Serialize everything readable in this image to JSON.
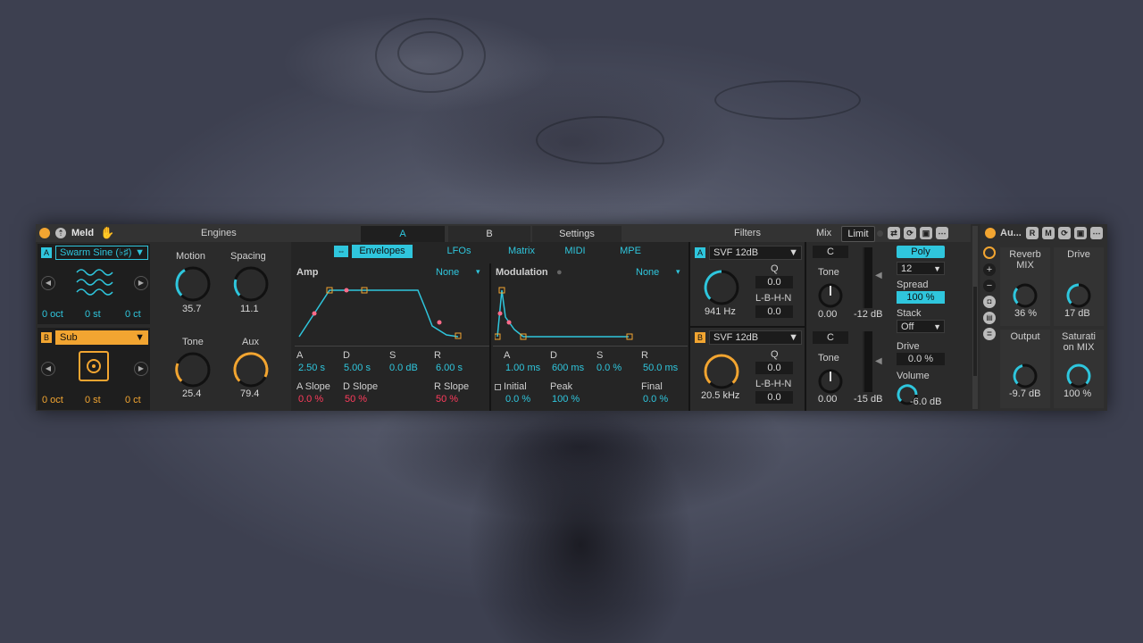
{
  "device_title": "Meld",
  "engines": {
    "header": "Engines",
    "osc_a": {
      "badge": "A",
      "name": "Swarm Sine (♭♯)",
      "oct": "0 oct",
      "st": "0 st",
      "ct": "0 ct"
    },
    "osc_b": {
      "badge": "B",
      "name": "Sub",
      "oct": "0 oct",
      "st": "0 st",
      "ct": "0 ct"
    },
    "motion": {
      "label": "Motion",
      "value": "35.7"
    },
    "spacing": {
      "label": "Spacing",
      "value": "11.1"
    },
    "tone": {
      "label": "Tone",
      "value": "25.4"
    },
    "aux": {
      "label": "Aux",
      "value": "79.4"
    }
  },
  "tabs": {
    "a": "A",
    "b": "B",
    "settings": "Settings"
  },
  "subtabs": {
    "envelopes": "Envelopes",
    "lfos": "LFOs",
    "matrix": "Matrix",
    "midi": "MIDI",
    "mpe": "MPE"
  },
  "amp": {
    "label": "Amp",
    "select": "None",
    "a_label": "A",
    "a": "2.50 s",
    "d_label": "D",
    "d": "5.00 s",
    "s_label": "S",
    "s": "0.0 dB",
    "r_label": "R",
    "r": "6.00 s",
    "a_slope_label": "A Slope",
    "a_slope": "0.0 %",
    "d_slope_label": "D Slope",
    "d_slope": "50 %",
    "r_slope_label": "R Slope",
    "r_slope": "50 %"
  },
  "modulation": {
    "label": "Modulation",
    "select": "None",
    "a_label": "A",
    "a": "1.00 ms",
    "d_label": "D",
    "d": "600 ms",
    "s_label": "S",
    "s": "0.0 %",
    "r_label": "R",
    "r": "50.0 ms",
    "initial_label": "Initial",
    "initial": "0.0 %",
    "peak_label": "Peak",
    "peak": "100 %",
    "final_label": "Final",
    "final": "0.0 %"
  },
  "filters": {
    "header": "Filters",
    "filter_a": {
      "badge": "A",
      "type": "SVF 12dB",
      "q_label": "Q",
      "q": "0.0",
      "mode_label": "L-B-H-N",
      "mode": "0.0",
      "freq": "941 Hz"
    },
    "filter_b": {
      "badge": "B",
      "type": "SVF 12dB",
      "q_label": "Q",
      "q": "0.0",
      "mode_label": "L-B-H-N",
      "mode": "0.0",
      "freq": "20.5 kHz"
    }
  },
  "mix": {
    "header": "Mix",
    "limit": "Limit",
    "a": {
      "c": "C",
      "tone_label": "Tone",
      "tone": "0.00",
      "level": "-12 dB"
    },
    "b": {
      "c": "C",
      "tone_label": "Tone",
      "tone": "0.00",
      "level": "-15 dB"
    },
    "poly": "Poly",
    "voices": "12",
    "spread_label": "Spread",
    "spread": "100 %",
    "stack_label": "Stack",
    "stack": "Off",
    "drive_label": "Drive",
    "drive": "0.0 %",
    "volume_label": "Volume",
    "volume": "-6.0 dB"
  },
  "rack": {
    "title": "Au...",
    "r": "R",
    "m": "M",
    "reverb_label": "Reverb MIX",
    "reverb": "36 %",
    "drive_label": "Drive",
    "drive": "17 dB",
    "output_label": "Output",
    "output": "-9.7 dB",
    "saturation_label": "Saturati on MIX",
    "saturation": "100 %"
  },
  "colors": {
    "accent_cyan": "#2fc6dd",
    "accent_orange": "#f2a531",
    "slope_red": "#ff3b5c",
    "panel": "#2b2b2b"
  }
}
